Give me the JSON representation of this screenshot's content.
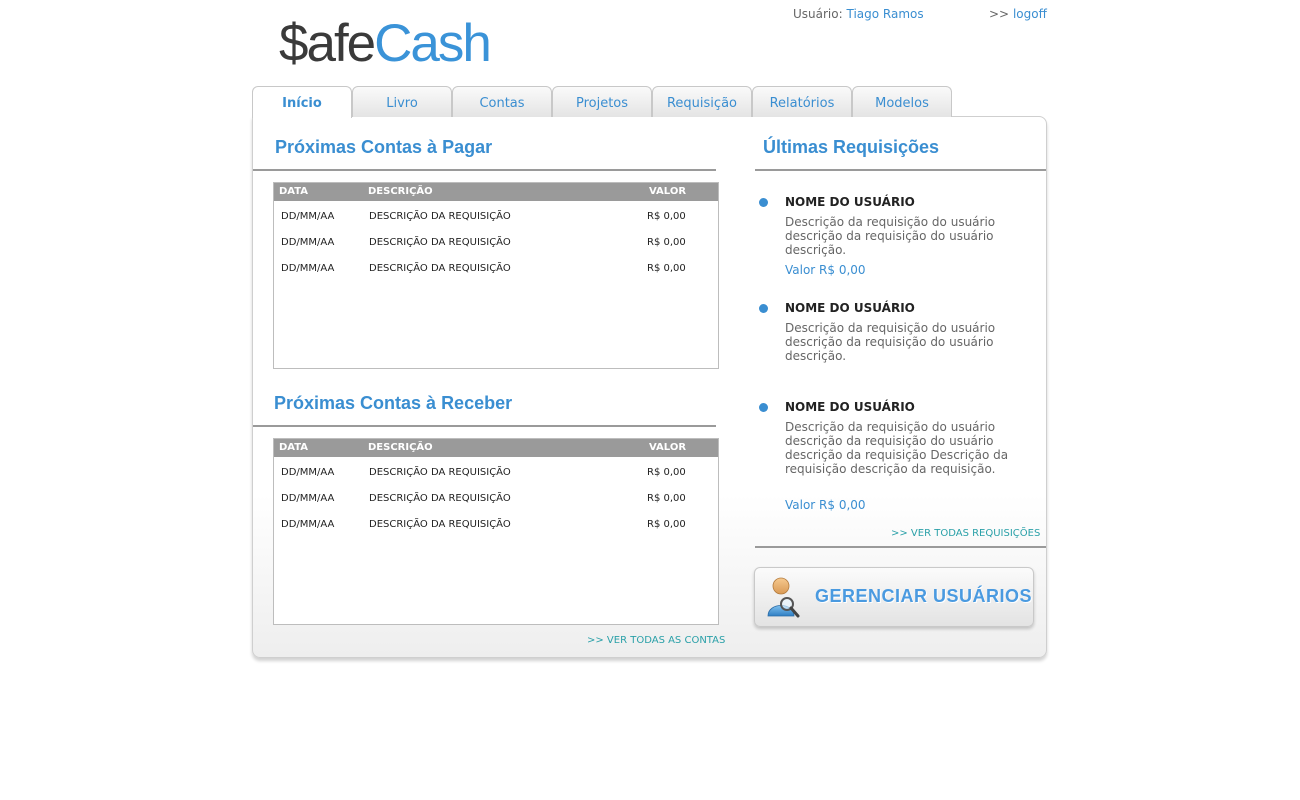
{
  "header": {
    "logo_part1": "$afe",
    "logo_part2": "Cash",
    "user_label": "Usuário:",
    "user_name": "Tiago Ramos",
    "logoff_prefix": ">>",
    "logoff_label": "logoff"
  },
  "tabs": [
    {
      "label": "Início",
      "active": true
    },
    {
      "label": "Livro"
    },
    {
      "label": "Contas"
    },
    {
      "label": "Projetos"
    },
    {
      "label": "Requisição"
    },
    {
      "label": "Relatórios"
    },
    {
      "label": "Modelos"
    }
  ],
  "pagar": {
    "title": "Próximas Contas à Pagar",
    "headers": {
      "date": "DATA",
      "desc": "DESCRIÇÃO",
      "value": "VALOR"
    },
    "rows": [
      {
        "date": "DD/MM/AA",
        "desc": "DESCRIÇÃO DA REQUISIÇÃO",
        "value": "R$ 0,00"
      },
      {
        "date": "DD/MM/AA",
        "desc": "DESCRIÇÃO DA REQUISIÇÃO",
        "value": "R$ 0,00"
      },
      {
        "date": "DD/MM/AA",
        "desc": "DESCRIÇÃO DA REQUISIÇÃO",
        "value": "R$ 0,00"
      }
    ]
  },
  "receber": {
    "title": "Próximas Contas à Receber",
    "headers": {
      "date": "DATA",
      "desc": "DESCRIÇÃO",
      "value": "VALOR"
    },
    "rows": [
      {
        "date": "DD/MM/AA",
        "desc": "DESCRIÇÃO DA REQUISIÇÃO",
        "value": "R$ 0,00"
      },
      {
        "date": "DD/MM/AA",
        "desc": "DESCRIÇÃO DA REQUISIÇÃO",
        "value": "R$ 0,00"
      },
      {
        "date": "DD/MM/AA",
        "desc": "DESCRIÇÃO DA REQUISIÇÃO",
        "value": "R$ 0,00"
      }
    ],
    "see_all": ">> VER TODAS AS CONTAS"
  },
  "requisicoes": {
    "title": "Últimas Requisições",
    "items": [
      {
        "name": "NOME DO USUÁRIO",
        "desc": "Descrição da requisição do usuário descrição da requisição do usuário descrição.",
        "value": "Valor R$ 0,00"
      },
      {
        "name": "NOME DO USUÁRIO",
        "desc": "Descrição da requisição do usuário descrição da requisição do usuário descrição."
      },
      {
        "name": "NOME DO USUÁRIO",
        "desc": "Descrição da requisição do usuário descrição da requisição do usuário descrição da requisição Descrição da requisição descrição da requisição.",
        "value": "Valor R$ 0,00"
      }
    ],
    "see_all": ">> VER TODAS REQUISIÇÕES"
  },
  "manage_users": {
    "label": "GERENCIAR USUÁRIOS",
    "icon": "user-search-icon"
  },
  "colors": {
    "accent": "#3a8ed1",
    "table_header": "#9a9a9a",
    "link_teal": "#2aa0a8"
  }
}
